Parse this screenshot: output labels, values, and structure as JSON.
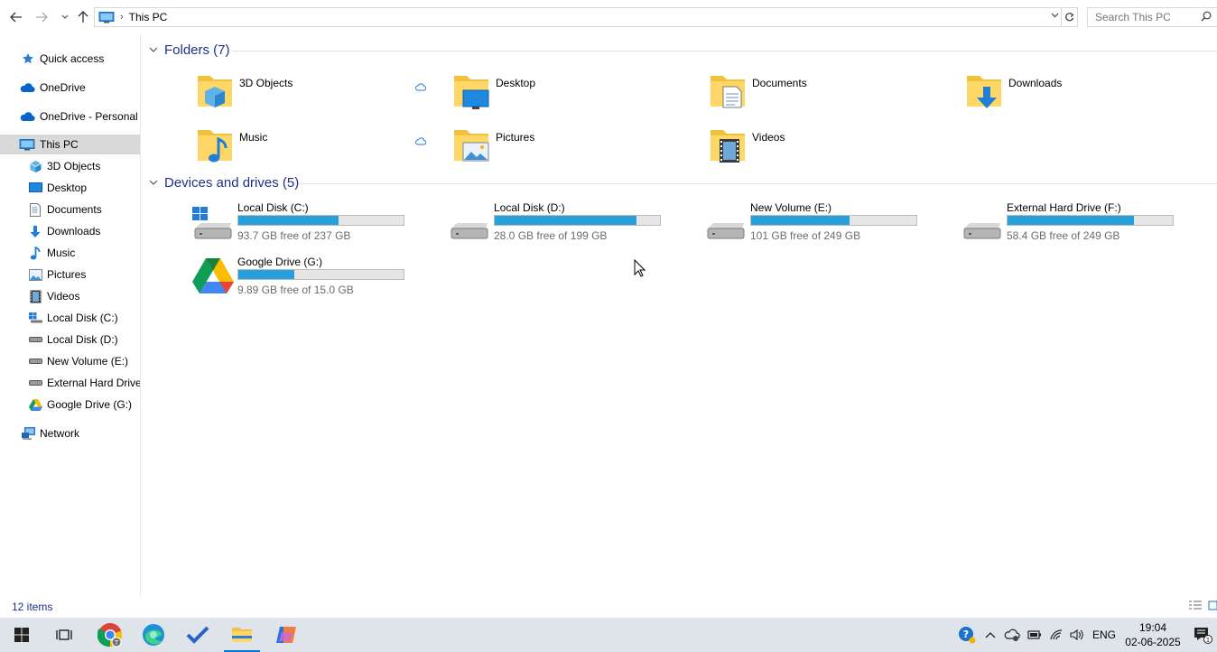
{
  "address": {
    "location": "This PC",
    "search_placeholder": "Search This PC"
  },
  "sidebar": {
    "items": [
      {
        "label": "Quick access"
      },
      {
        "label": "OneDrive"
      },
      {
        "label": "OneDrive - Personal"
      },
      {
        "label": "This PC"
      },
      {
        "label": "3D Objects"
      },
      {
        "label": "Desktop"
      },
      {
        "label": "Documents"
      },
      {
        "label": "Downloads"
      },
      {
        "label": "Music"
      },
      {
        "label": "Pictures"
      },
      {
        "label": "Videos"
      },
      {
        "label": "Local Disk (C:)"
      },
      {
        "label": "Local Disk (D:)"
      },
      {
        "label": "New Volume (E:)"
      },
      {
        "label": "External Hard Drive"
      },
      {
        "label": "Google Drive (G:)"
      },
      {
        "label": "Network"
      }
    ],
    "selected": "This PC"
  },
  "folders": {
    "header": "Folders (7)",
    "items": [
      {
        "name": "3D Objects"
      },
      {
        "name": "Desktop"
      },
      {
        "name": "Documents"
      },
      {
        "name": "Downloads"
      },
      {
        "name": "Music"
      },
      {
        "name": "Pictures"
      },
      {
        "name": "Videos"
      }
    ]
  },
  "drives": {
    "header": "Devices and drives (5)",
    "items": [
      {
        "name": "Local Disk (C:)",
        "free_text": "93.7 GB free of 237 GB",
        "used_fraction": 0.605
      },
      {
        "name": "Local Disk (D:)",
        "free_text": "28.0 GB free of 199 GB",
        "used_fraction": 0.859
      },
      {
        "name": "New Volume (E:)",
        "free_text": "101 GB free of 249 GB",
        "used_fraction": 0.594
      },
      {
        "name": "External Hard Drive (F:)",
        "free_text": "58.4 GB free of 249 GB",
        "used_fraction": 0.765
      },
      {
        "name": "Google Drive (G:)",
        "free_text": "9.89 GB free of 15.0 GB",
        "used_fraction": 0.341
      }
    ]
  },
  "status": {
    "item_count": "12 items"
  },
  "taskbar": {
    "tray_language": "ENG",
    "time": "19:04",
    "date": "02-06-2025",
    "notification_count": "1"
  },
  "colors": {
    "bar_fill": "#26a0da",
    "accent": "#0078d4",
    "link_blue": "#1e3287"
  }
}
